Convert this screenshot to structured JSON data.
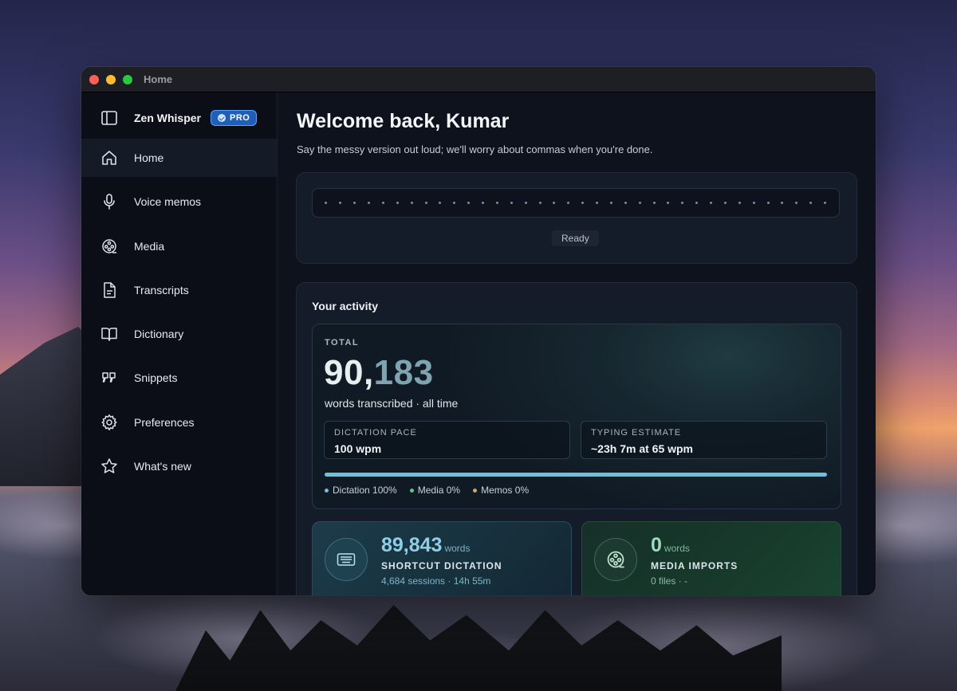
{
  "window": {
    "title": "Home"
  },
  "sidebar": {
    "app_name": "Zen Whisper",
    "badge": "PRO",
    "items": [
      {
        "label": "Home",
        "icon": "home-icon",
        "active": true
      },
      {
        "label": "Voice memos",
        "icon": "microphone-icon"
      },
      {
        "label": "Media",
        "icon": "film-reel-icon"
      },
      {
        "label": "Transcripts",
        "icon": "document-icon"
      },
      {
        "label": "Dictionary",
        "icon": "book-icon"
      },
      {
        "label": "Snippets",
        "icon": "quote-icon"
      },
      {
        "label": "Preferences",
        "icon": "gear-icon"
      },
      {
        "label": "What's new",
        "icon": "star-icon"
      }
    ]
  },
  "main": {
    "welcome": "Welcome back, Kumar",
    "subtitle": "Say the messy version out loud; we'll worry about commas when you're done.",
    "recorder": {
      "status": "Ready"
    },
    "activity": {
      "title": "Your activity",
      "total": {
        "label": "TOTAL",
        "number_head": "90,",
        "number_tail": "183",
        "caption": "words transcribed · all time",
        "pace_label": "DICTATION PACE",
        "pace_value": "100 wpm",
        "typing_label": "TYPING ESTIMATE",
        "typing_value": "~23h 7m at 65 wpm",
        "dictation_share": 1.0,
        "legend": [
          {
            "label": "Dictation 100%",
            "color": "#6bc3d9"
          },
          {
            "label": "Media 0%",
            "color": "#5fc39a"
          },
          {
            "label": "Memos 0%",
            "color": "#d9a25f"
          }
        ]
      },
      "sources": [
        {
          "number": "89,843",
          "unit": "words",
          "title": "SHORTCUT DICTATION",
          "sub": "4,684 sessions · 14h 55m",
          "icon": "keyboard-icon"
        },
        {
          "number": "0",
          "unit": "words",
          "title": "MEDIA IMPORTS",
          "sub": "0 files · -",
          "icon": "film-reel-icon"
        }
      ]
    }
  },
  "colors": {
    "accent": "#6bc3d9",
    "pro_badge": "#1f5fb8"
  }
}
